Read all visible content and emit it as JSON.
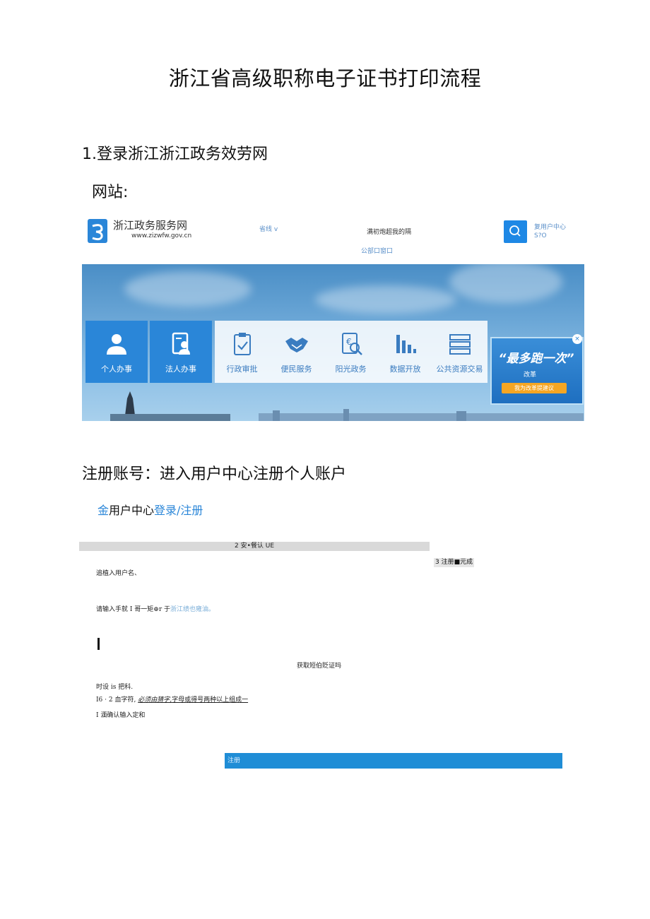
{
  "title": "浙江省高级职称电子证书打印流程",
  "step1": "1.登录浙江浙江政务效劳网",
  "website_label": "网站:",
  "portal": {
    "site_name": "浙江政务服务网",
    "site_domain": "www.zizwfw.gov.cn",
    "region": "省线 v",
    "slogan": "满初炮超我的隔",
    "dept_window": "公部口窗口",
    "user_center_1": "复用户中心",
    "user_center_2": "S?O",
    "tiles": [
      "个人办事",
      "法人办事",
      "行政审批",
      "便民服务",
      "阳光政务",
      "数据开放",
      "公共资源交易"
    ],
    "promo_main": "“最多跑一次”",
    "promo_sub": "改革",
    "promo_button": "我为改革提建议",
    "promo_close": "×"
  },
  "step2": "注册账号：进入用户中心注册个人账户",
  "user_center": {
    "prefix": "金",
    "label": "用户中心",
    "login_register": "登录/注册"
  },
  "form": {
    "progress": "2 安•餐认 UE",
    "step3": "3 注册■元成",
    "username_hint": "追植入用户名、",
    "phone_hint_prefix": "请输入手就 I 哥一矩⊕r 于",
    "phone_hint_link": "浙江绩也雍油。",
    "sms_code": "获取短伯貶证吗",
    "password_hint": "时设 is 把科.",
    "rule_prefix": "I6 ·  2 血字符,",
    "rule_italic": "必须由猜字,",
    "rule_rest": "字母或得号两种以上组成一",
    "confirm_hint": "I 湎确认输入定和",
    "register_button": "注册"
  }
}
